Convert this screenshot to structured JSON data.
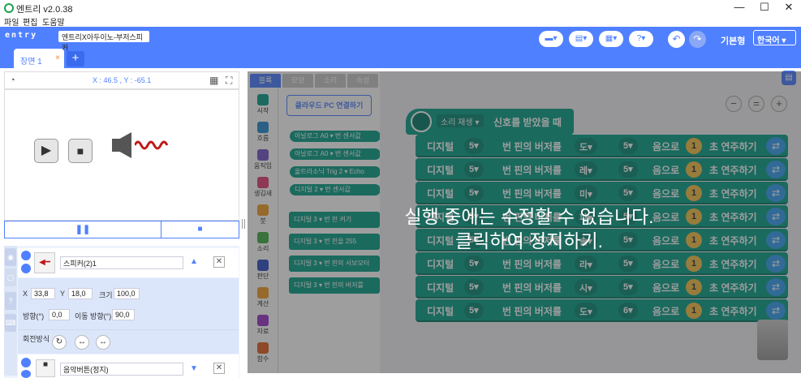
{
  "window": {
    "title": "엔트리 v2.0.38",
    "minimize": "—",
    "maximize": "☐",
    "close": "✕"
  },
  "menu": [
    "파일",
    "편집",
    "도움말"
  ],
  "header": {
    "logo": "entry",
    "project_name": "엔트리X아두이노-부저스피커",
    "mode": "기본형",
    "language": "한국어"
  },
  "scene_tab": {
    "label": "장면 1",
    "close": "×",
    "add": "+"
  },
  "stage": {
    "coordinates": "X : 46.5 , Y : -65.1"
  },
  "objects": [
    {
      "name": "스피커(2)1"
    },
    {
      "name": "음악버튼(정지)"
    }
  ],
  "object_props": {
    "x_label": "X",
    "x_value": "33,8",
    "y_label": "Y",
    "y_value": "18,0",
    "size_label": "크기",
    "size_value": "100,0",
    "direction_label": "방향(°)",
    "direction_value": "0,0",
    "move_dir_label": "이동 방향(°)",
    "move_dir_value": "90,0",
    "rotation_label": "회전방식"
  },
  "category_tabs": [
    "블록",
    "모양",
    "소리",
    "속성"
  ],
  "categories": [
    {
      "label": "시작",
      "color": "#12a08a"
    },
    {
      "label": "흐름",
      "color": "#2b8fd0"
    },
    {
      "label": "움직임",
      "color": "#7a5acb"
    },
    {
      "label": "생김새",
      "color": "#e0457b"
    },
    {
      "label": "붓",
      "color": "#f0a030"
    },
    {
      "label": "소리",
      "color": "#47b04a"
    },
    {
      "label": "판단",
      "color": "#3656c5"
    },
    {
      "label": "계산",
      "color": "#f0a030"
    },
    {
      "label": "자료",
      "color": "#9b3cc8"
    },
    {
      "label": "함수",
      "color": "#e0642a"
    }
  ],
  "palette": {
    "connect_button": "클라우드 PC 연결하기",
    "blocks": [
      "아날로그 A0 ▾ 번 센서값",
      "아날로그 A0 ▾ 번 센서값",
      "울트라소닉 Trig 2 ▾ Echo",
      "디지털 2 ▾ 번 센서값",
      "디지털 3 ▾ 번 핀 켜기",
      "디지털 3 ▾ 번 핀을 255",
      "디지털 3 ▾ 번 핀의 서보모터",
      "디지털 3 ▾ 번 핀의 버저를"
    ]
  },
  "script": {
    "hat_select": "소리 재생 ▾",
    "hat_text": "신호를 받았을 때",
    "rows": [
      {
        "prefix": "디지털",
        "pin": "5▾",
        "mid": "번 핀의 버저를",
        "note": "도▾",
        "octave": "5▾",
        "suffix": "음으로",
        "beats": "1",
        "end": "초 연주하기"
      },
      {
        "prefix": "디지털",
        "pin": "5▾",
        "mid": "번 핀의 버저를",
        "note": "레▾",
        "octave": "5▾",
        "suffix": "음으로",
        "beats": "1",
        "end": "초 연주하기"
      },
      {
        "prefix": "디지털",
        "pin": "5▾",
        "mid": "번 핀의 버저를",
        "note": "미▾",
        "octave": "5▾",
        "suffix": "음으로",
        "beats": "1",
        "end": "초 연주하기"
      },
      {
        "prefix": "디지털",
        "pin": "5▾",
        "mid": "번 핀의 버저를",
        "note": "파▾",
        "octave": "5▾",
        "suffix": "음으로",
        "beats": "1",
        "end": "초 연주하기"
      },
      {
        "prefix": "디지털",
        "pin": "5▾",
        "mid": "번 핀의 버저를",
        "note": "솔▾",
        "octave": "5▾",
        "suffix": "음으로",
        "beats": "1",
        "end": "초 연주하기"
      },
      {
        "prefix": "디지털",
        "pin": "5▾",
        "mid": "번 핀의 버저를",
        "note": "라▾",
        "octave": "5▾",
        "suffix": "음으로",
        "beats": "1",
        "end": "초 연주하기"
      },
      {
        "prefix": "디지털",
        "pin": "5▾",
        "mid": "번 핀의 버저를",
        "note": "시▾",
        "octave": "5▾",
        "suffix": "음으로",
        "beats": "1",
        "end": "초 연주하기"
      },
      {
        "prefix": "디지털",
        "pin": "5▾",
        "mid": "번 핀의 버저를",
        "note": "도▾",
        "octave": "6▾",
        "suffix": "음으로",
        "beats": "1",
        "end": "초 연주하기"
      }
    ]
  },
  "overlay": {
    "line1": "실행 중에는 수정할 수 없습니다.",
    "line2": "클릭하여 정지하기."
  },
  "zoom": {
    "out": "−",
    "reset": "=",
    "in": "+"
  }
}
